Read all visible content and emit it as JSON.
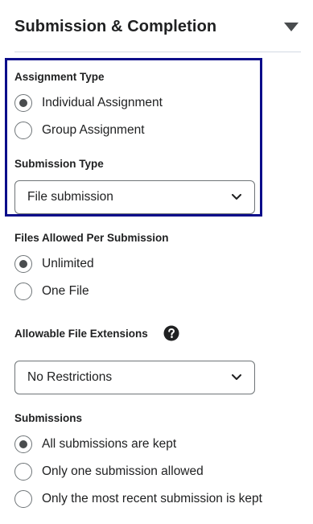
{
  "section": {
    "title": "Submission & Completion"
  },
  "assignment_type": {
    "label": "Assignment Type",
    "options": [
      {
        "label": "Individual Assignment",
        "checked": true
      },
      {
        "label": "Group Assignment",
        "checked": false
      }
    ]
  },
  "submission_type": {
    "label": "Submission Type",
    "selected": "File submission"
  },
  "files_allowed": {
    "label": "Files Allowed Per Submission",
    "options": [
      {
        "label": "Unlimited",
        "checked": true
      },
      {
        "label": "One File",
        "checked": false
      }
    ]
  },
  "file_extensions": {
    "label": "Allowable File Extensions",
    "help_icon": "question-circle-icon",
    "selected": "No Restrictions"
  },
  "submissions": {
    "label": "Submissions",
    "options": [
      {
        "label": "All submissions are kept",
        "checked": true
      },
      {
        "label": "Only one submission allowed",
        "checked": false
      },
      {
        "label": "Only the most recent submission is kept",
        "checked": false
      }
    ]
  },
  "colors": {
    "highlight_border": "#0b0d8a",
    "text": "#202122",
    "divider": "#d3d9e3"
  }
}
